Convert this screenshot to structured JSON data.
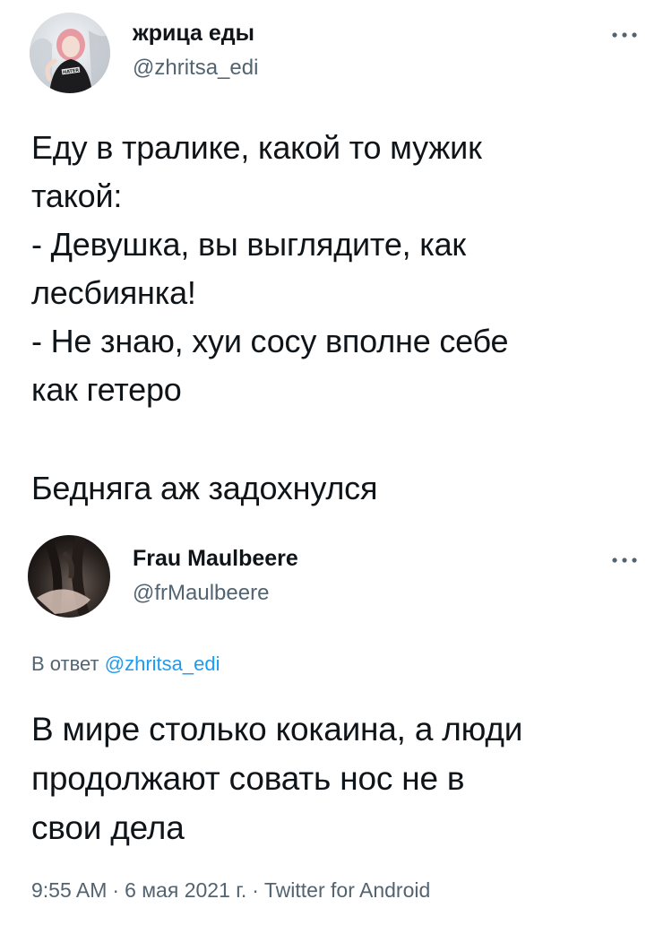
{
  "tweet": {
    "author": {
      "display_name": "жрица еды",
      "handle": "@zhritsa_edi",
      "avatar_text": "HATER"
    },
    "more_icon": "more-horizontal-icon",
    "text_lines": [
      "Еду в тралике, какой то мужик",
      "такой:",
      "- Девушка, вы выглядите, как",
      "лесбиянка!",
      "- Не знаю, хуи сосу вполне себе",
      "как гетеро"
    ],
    "text_tail": "Бедняга аж задохнулся"
  },
  "reply": {
    "author": {
      "display_name": "Frau Maulbeere",
      "handle": "@frMaulbeere"
    },
    "more_icon": "more-horizontal-icon",
    "reply_prefix": "В ответ",
    "reply_to": "@zhritsa_edi",
    "text_lines": [
      "В мире столько кокаина, а люди",
      "продолжают совать нос не в",
      "свои дела"
    ],
    "time": "9:55 AM",
    "date": "6 мая 2021 г.",
    "separator": "·",
    "source": "Twitter for Android"
  },
  "colors": {
    "text_primary": "#0f1419",
    "text_secondary": "#536471",
    "link": "#1d9bf0"
  }
}
